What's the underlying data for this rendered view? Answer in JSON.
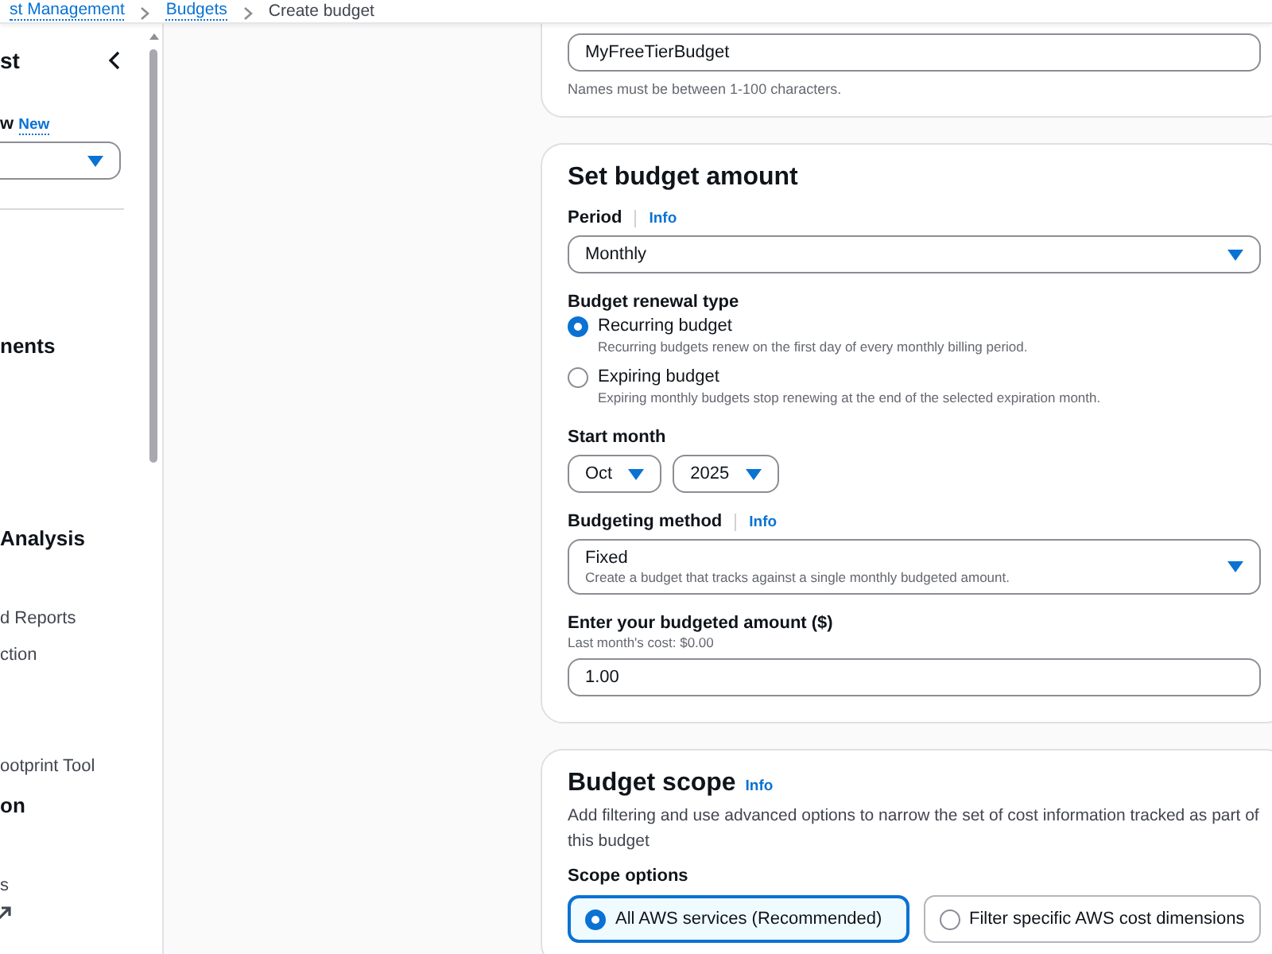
{
  "breadcrumb": [
    {
      "label": "st Management",
      "kind": "link"
    },
    {
      "label": "Budgets",
      "kind": "link"
    },
    {
      "label": "Create budget",
      "kind": "current"
    }
  ],
  "sidebar": {
    "title": "st",
    "view_label": "w",
    "new_badge": "New",
    "items": [
      {
        "label": "nents",
        "kind": "heading"
      },
      {
        "label": "Analysis",
        "kind": "heading"
      },
      {
        "label": "d Reports",
        "kind": "link"
      },
      {
        "label": "ction",
        "kind": "link"
      },
      {
        "label": "ootprint Tool",
        "kind": "link"
      },
      {
        "label": "on",
        "kind": "heading"
      },
      {
        "label": "s",
        "kind": "external"
      }
    ]
  },
  "name_card": {
    "value": "MyFreeTierBudget",
    "hint": "Names must be between 1-100 characters."
  },
  "amount_card": {
    "title": "Set budget amount",
    "period": {
      "label": "Period",
      "info": "Info",
      "value": "Monthly"
    },
    "renewal": {
      "label": "Budget renewal type",
      "options": [
        {
          "label": "Recurring budget",
          "description": "Recurring budgets renew on the first day of every monthly billing period.",
          "selected": true
        },
        {
          "label": "Expiring budget",
          "description": "Expiring monthly budgets stop renewing at the end of the selected expiration month.",
          "selected": false
        }
      ]
    },
    "start_month": {
      "label": "Start month",
      "month": "Oct",
      "year": "2025"
    },
    "method": {
      "label": "Budgeting method",
      "info": "Info",
      "value": "Fixed",
      "description": "Create a budget that tracks against a single monthly budgeted amount."
    },
    "amount": {
      "label": "Enter your budgeted amount ($)",
      "hint": "Last month's cost: $0.00",
      "value": "1.00"
    }
  },
  "scope_card": {
    "title": "Budget scope",
    "info": "Info",
    "description": "Add filtering and use advanced options to narrow the set of cost information tracked as part of this budget",
    "options_label": "Scope options",
    "options": [
      {
        "label": "All AWS services (Recommended)",
        "selected": true
      },
      {
        "label": "Filter specific AWS cost dimensions",
        "selected": false
      }
    ]
  }
}
